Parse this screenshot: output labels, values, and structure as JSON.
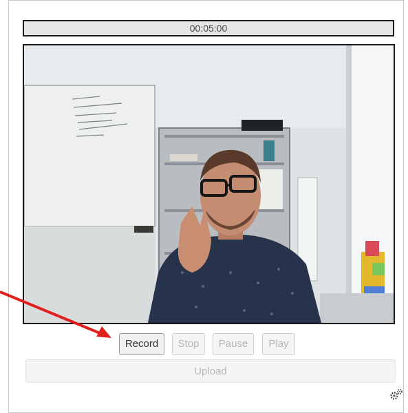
{
  "recorder": {
    "timer": "00:05:00",
    "buttons": {
      "record": "Record",
      "stop": "Stop",
      "pause": "Pause",
      "play": "Play"
    },
    "upload": "Upload",
    "settings_icon": "gears-icon"
  },
  "annotation": {
    "arrow_color": "#e0201c",
    "arrow_target": "record-button"
  }
}
